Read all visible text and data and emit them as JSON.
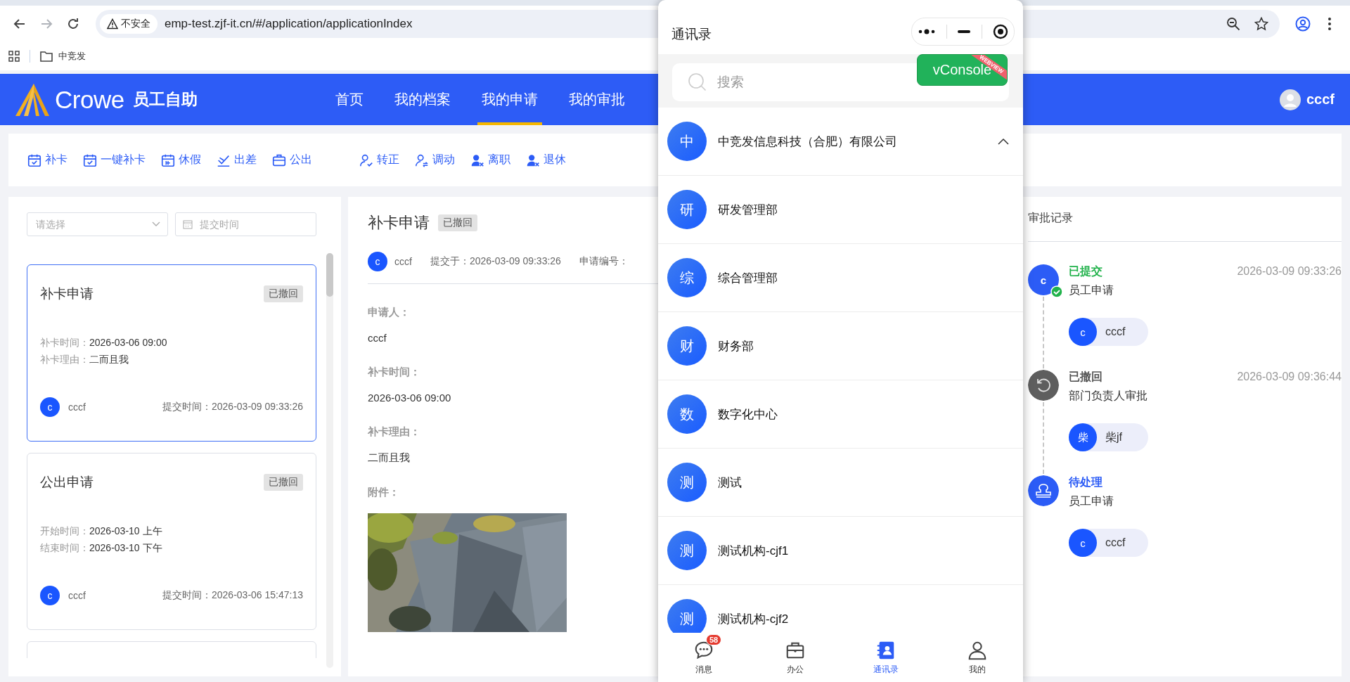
{
  "browser": {
    "nav_buttons": [
      {
        "kind": "back",
        "disabled": false
      },
      {
        "kind": "forward",
        "disabled": true
      },
      {
        "kind": "reload",
        "disabled": false
      }
    ],
    "security_label": "不安全",
    "url": "emp-test.zjf-it.cn/#/application/applicationIndex",
    "bookmarks": [
      {
        "label": "中竞发"
      }
    ]
  },
  "header": {
    "logo_text": "Crowe",
    "brand": "员工自助",
    "nav": [
      {
        "label": "首页",
        "selected": false
      },
      {
        "label": "我的档案",
        "selected": false
      },
      {
        "label": "我的申请",
        "selected": true
      },
      {
        "label": "我的审批",
        "selected": false
      }
    ],
    "user": "cccf"
  },
  "toolbar": {
    "groups": [
      {
        "items": [
          {
            "kind": "calendar-check",
            "label": "补卡"
          },
          {
            "kind": "calendar-check",
            "label": "一键补卡"
          },
          {
            "kind": "calendar",
            "label": "休假"
          },
          {
            "kind": "signature",
            "label": "出差"
          },
          {
            "kind": "briefcase",
            "label": "公出"
          }
        ]
      },
      {
        "items": [
          {
            "kind": "user-check",
            "label": "转正"
          },
          {
            "kind": "user-arrows",
            "label": "调动"
          },
          {
            "kind": "user-x",
            "label": "离职"
          },
          {
            "kind": "user-x",
            "label": "退休"
          }
        ]
      }
    ]
  },
  "filters": {
    "select_placeholder": "请选择",
    "date_placeholder": "提交时间"
  },
  "applications": [
    {
      "title": "补卡申请",
      "status": "已撤回",
      "selected": true,
      "fields": [
        {
          "label": "补卡时间：",
          "value": "2026-03-06 09:00"
        },
        {
          "label": "补卡理由：",
          "value": "二而且我"
        }
      ],
      "avatar": "c",
      "user": "cccf",
      "submitted": "提交时间：2026-03-09 09:33:26"
    },
    {
      "title": "公出申请",
      "status": "已撤回",
      "selected": false,
      "fields": [
        {
          "label": "开始时间：",
          "value": "2026-03-10 上午"
        },
        {
          "label": "结束时间：",
          "value": "2026-03-10 下午"
        }
      ],
      "avatar": "c",
      "user": "cccf",
      "submitted": "提交时间：2026-03-06 15:47:13"
    }
  ],
  "detail": {
    "title": "补卡申请",
    "status": "已撤回",
    "avatar": "c",
    "user": "cccf",
    "submitted": "提交于：2026-03-09 09:33:26",
    "number_label": "申请编号：",
    "fields": [
      {
        "label": "申请人：",
        "value": "cccf"
      },
      {
        "label": "补卡时间：",
        "value": "2026-03-06 09:00"
      },
      {
        "label": "补卡理由：",
        "value": "二而且我"
      }
    ],
    "attachments_label": "附件："
  },
  "approval": {
    "title": "审批记录",
    "steps": [
      {
        "kind": "submitted",
        "status": "已提交",
        "avatar": "c",
        "node": "员工申请",
        "time": "2026-03-09 09:33:26",
        "approver_avatar": "c",
        "approver": "cccf"
      },
      {
        "kind": "withdrawn",
        "status": "已撤回",
        "node": "部门负责人审批",
        "time": "2026-03-09 09:36:44",
        "approver_avatar": "柴",
        "approver": "柴jf"
      },
      {
        "kind": "pending",
        "status": "待处理",
        "node": "员工申请",
        "approver_avatar": "c",
        "approver": "cccf"
      }
    ]
  },
  "popup": {
    "title": "通讯录",
    "search_placeholder": "搜索",
    "vconsole": {
      "label": "vConsole",
      "ribbon": "WEBVIEW"
    },
    "org": {
      "avatar": "中",
      "name": "中竞发信息科技（合肥）有限公司",
      "expanded": true,
      "children": [
        {
          "avatar": "研",
          "name": "研发管理部"
        },
        {
          "avatar": "综",
          "name": "综合管理部"
        },
        {
          "avatar": "财",
          "name": "财务部"
        },
        {
          "avatar": "数",
          "name": "数字化中心"
        },
        {
          "avatar": "测",
          "name": "测试"
        },
        {
          "avatar": "测",
          "name": "测试机构-cjf1"
        },
        {
          "avatar": "测",
          "name": "测试机构-cjf2"
        }
      ]
    },
    "tabs": [
      {
        "kind": "chat",
        "label": "消息",
        "selected": false,
        "badge": "58"
      },
      {
        "kind": "briefcase",
        "label": "办公",
        "selected": false
      },
      {
        "kind": "contacts",
        "label": "通讯录",
        "selected": true
      },
      {
        "kind": "person",
        "label": "我的",
        "selected": false
      }
    ]
  }
}
